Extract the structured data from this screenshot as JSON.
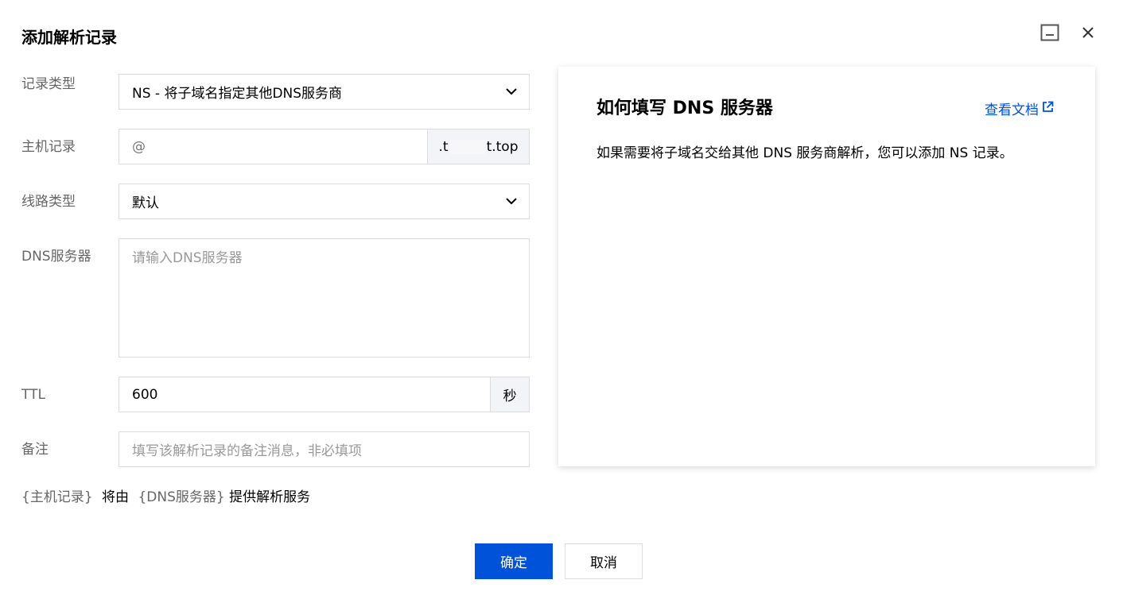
{
  "dialog": {
    "title": "添加解析记录"
  },
  "form": {
    "record_type": {
      "label": "记录类型",
      "value": "NS - 将子域名指定其他DNS服务商"
    },
    "host": {
      "label": "主机记录",
      "placeholder": "@",
      "suffix_start": ".t",
      "suffix_end": "t.top"
    },
    "line": {
      "label": "线路类型",
      "value": "默认"
    },
    "dns_server": {
      "label": "DNS服务器",
      "placeholder": "请输入DNS服务器"
    },
    "ttl": {
      "label": "TTL",
      "value": "600",
      "unit": "秒"
    },
    "remark": {
      "label": "备注",
      "placeholder": "填写该解析记录的备注消息，非必填项"
    }
  },
  "summary": {
    "host_var": "{主机记录}",
    "connector": "将由",
    "dns_var": "{DNS服务器}",
    "tail": "提供解析服务"
  },
  "help": {
    "title": "如何填写 DNS 服务器",
    "link_label": "查看文档",
    "text": "如果需要将子域名交给其他 DNS 服务商解析，您可以添加 NS 记录。"
  },
  "buttons": {
    "confirm": "确定",
    "cancel": "取消"
  },
  "colors": {
    "primary": "#0052d9",
    "border": "#dcdcdc",
    "label": "#666666",
    "placeholder": "#999999"
  },
  "icons": {
    "minimize": "minimize-icon",
    "close": "close-icon",
    "dropdown": "chevron-down-icon",
    "external": "external-link-icon"
  }
}
